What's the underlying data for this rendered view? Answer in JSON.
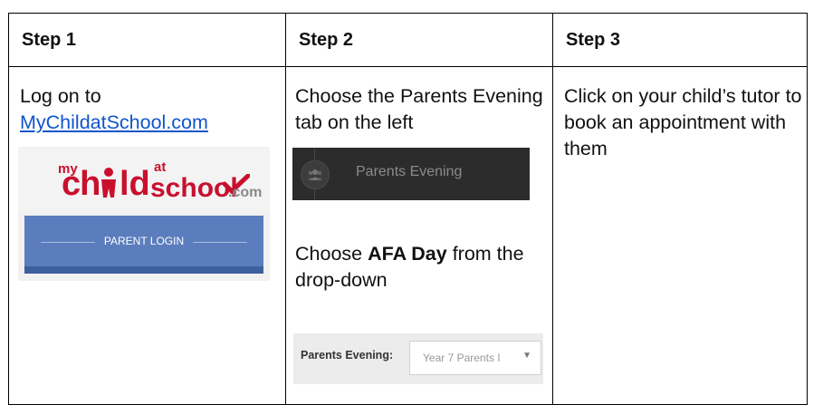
{
  "headers": [
    "Step 1",
    "Step 2",
    "Step 3"
  ],
  "step1": {
    "text_before_link": "Log on to",
    "link_text": "MyChildatSchool.com",
    "logo": {
      "my": "my",
      "ch": "ch",
      "ild": "ld",
      "at": "at",
      "school": "school",
      "com": ".com"
    },
    "login_button_label": "PARENT LOGIN"
  },
  "step2": {
    "instruction1": "Choose the Parents Evening tab on the left",
    "tab_label": "Parents Evening",
    "instruction2_prefix": "Choose ",
    "instruction2_bold": "AFA Day",
    "instruction2_suffix": " from the drop-down",
    "dropdown_label": "Parents Evening:",
    "dropdown_value": "Year 7 Parents I",
    "dropdown_caret": "▼"
  },
  "step3": {
    "instruction": "Click on your child’s tutor to book an appointment with them"
  },
  "colors": {
    "link": "#1155cc",
    "brand_red": "#c8102e",
    "login_blue": "#5b7dbd",
    "dark_tab": "#2c2c2c"
  }
}
